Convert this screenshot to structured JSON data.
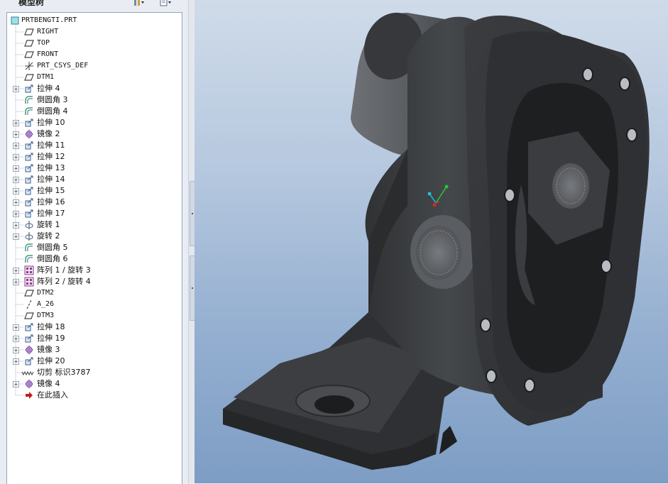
{
  "panel": {
    "title": "模型树"
  },
  "tree": {
    "root": "PRTBENGTI.PRT",
    "items": [
      {
        "label": "RIGHT",
        "icon": "datum-plane-icon",
        "exp": false
      },
      {
        "label": "TOP",
        "icon": "datum-plane-icon",
        "exp": false
      },
      {
        "label": "FRONT",
        "icon": "datum-plane-icon",
        "exp": false
      },
      {
        "label": "PRT_CSYS_DEF",
        "icon": "coordinate-system-icon",
        "exp": false
      },
      {
        "label": "DTM1",
        "icon": "datum-plane-icon",
        "exp": false
      },
      {
        "label": "拉伸 4",
        "icon": "extrude-icon",
        "exp": true
      },
      {
        "label": "倒圆角 3",
        "icon": "round-icon",
        "exp": false
      },
      {
        "label": "倒圆角 4",
        "icon": "round-icon",
        "exp": false
      },
      {
        "label": "拉伸 10",
        "icon": "extrude-icon",
        "exp": true
      },
      {
        "label": "镜像 2",
        "icon": "mirror-icon",
        "exp": true
      },
      {
        "label": "拉伸 11",
        "icon": "extrude-icon",
        "exp": true
      },
      {
        "label": "拉伸 12",
        "icon": "extrude-icon",
        "exp": true
      },
      {
        "label": "拉伸 13",
        "icon": "extrude-icon",
        "exp": true
      },
      {
        "label": "拉伸 14",
        "icon": "extrude-icon",
        "exp": true
      },
      {
        "label": "拉伸 15",
        "icon": "extrude-icon",
        "exp": true
      },
      {
        "label": "拉伸 16",
        "icon": "extrude-icon",
        "exp": true
      },
      {
        "label": "拉伸 17",
        "icon": "extrude-icon",
        "exp": true
      },
      {
        "label": "旋转 1",
        "icon": "revolve-icon",
        "exp": true
      },
      {
        "label": "旋转 2",
        "icon": "revolve-icon",
        "exp": true
      },
      {
        "label": "倒圆角 5",
        "icon": "round-icon",
        "exp": false
      },
      {
        "label": "倒圆角 6",
        "icon": "round-icon",
        "exp": false
      },
      {
        "label": "阵列 1 / 旋转 3",
        "icon": "pattern-icon",
        "exp": true
      },
      {
        "label": "阵列 2 / 旋转 4",
        "icon": "pattern-icon",
        "exp": true
      },
      {
        "label": "DTM2",
        "icon": "datum-plane-icon",
        "exp": false
      },
      {
        "label": "A_26",
        "icon": "datum-axis-icon",
        "exp": false
      },
      {
        "label": "DTM3",
        "icon": "datum-plane-icon",
        "exp": false
      },
      {
        "label": "拉伸 18",
        "icon": "extrude-icon",
        "exp": true
      },
      {
        "label": "拉伸 19",
        "icon": "extrude-icon",
        "exp": true
      },
      {
        "label": "镜像 3",
        "icon": "mirror-icon",
        "exp": true
      },
      {
        "label": "拉伸 20",
        "icon": "extrude-icon",
        "exp": true
      },
      {
        "label": "切剪 标识3787",
        "icon": "cosmetic-thread-icon",
        "exp": false
      },
      {
        "label": "镜像 4",
        "icon": "mirror-icon",
        "exp": true
      },
      {
        "label": "在此插入",
        "icon": "insert-here-arrow-icon",
        "exp": false
      }
    ]
  },
  "colors": {
    "tree_border": "#8ea5c2",
    "model_body": "#3f4144",
    "viewport_top": "#cfdbe9",
    "viewport_bottom": "#7e9dc4"
  }
}
